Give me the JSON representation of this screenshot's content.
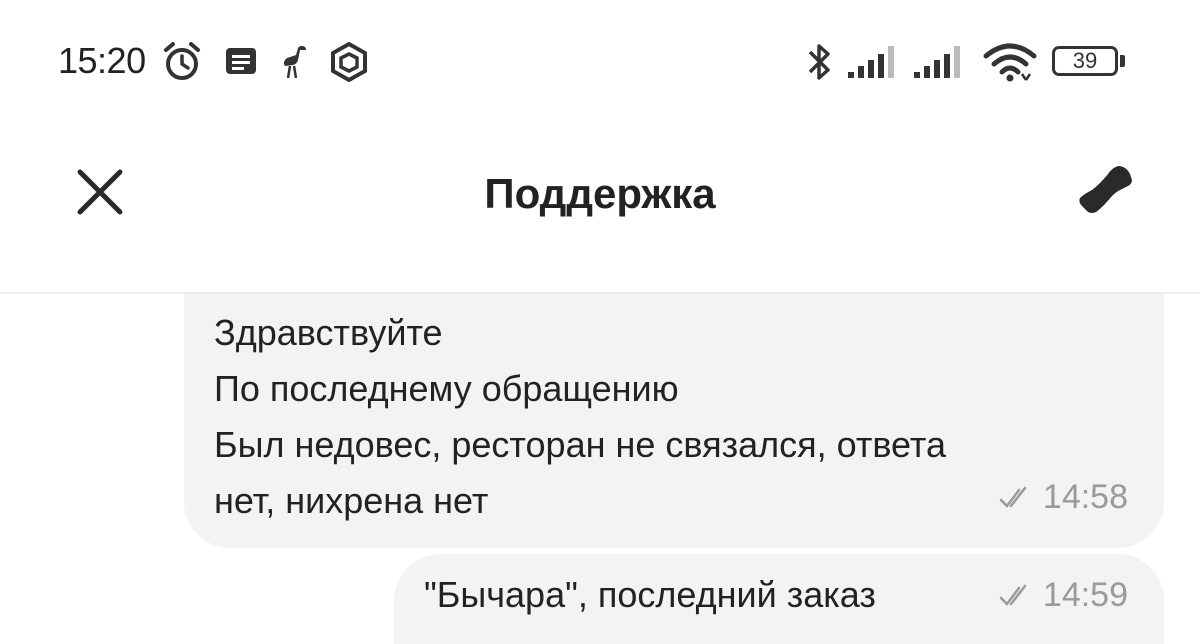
{
  "status_bar": {
    "time": "15:20",
    "battery": "39",
    "icons": [
      "alarm-icon",
      "message-icon",
      "ostrich-icon",
      "hex-app-icon",
      "bluetooth-icon",
      "signal-icon",
      "signal-icon",
      "wifi-icon",
      "battery-icon"
    ]
  },
  "header": {
    "title": "Поддержка",
    "close_icon": "close-icon",
    "call_icon": "phone-icon"
  },
  "messages": [
    {
      "lines": [
        "Здравствуйте",
        "По последнему обращению",
        "Был недовес, ресторан не связался, ответа",
        "нет, нихрена нет"
      ],
      "time": "14:58",
      "status_icon": "double-check-icon"
    },
    {
      "lines": [
        "\"Бычара\", последний заказ"
      ],
      "time": "14:59",
      "status_icon": "double-check-icon"
    }
  ],
  "colors": {
    "bubble": "#f3f3f3",
    "meta_text": "#9a9a9a",
    "title_text": "#222222"
  }
}
